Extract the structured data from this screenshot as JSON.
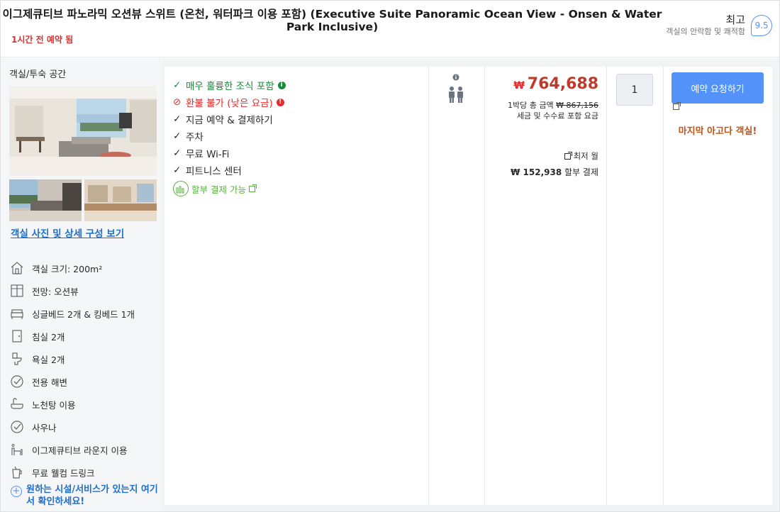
{
  "header": {
    "title_line1": "이그제큐티브 파노라믹 오션뷰 스위트 (온천, 워터파크 이용 포함) (Executive Suite Panoramic Ocean View - Onsen & Water",
    "title_line2": "Park Inclusive)",
    "booked_ago": "1시간 전 예약 됨",
    "rating_word": "최고",
    "rating_sub": "객실의 안락함 및 쾌적함",
    "rating_score": "9.5"
  },
  "room": {
    "section_title": "객실/투숙 공간",
    "photo_link": "객실 사진 및 상세 구성 보기",
    "amenities": [
      {
        "icon": "room-size-icon",
        "label": "객실 크기: 200m²"
      },
      {
        "icon": "window-view-icon",
        "label": "전망: 오션뷰"
      },
      {
        "icon": "bed-icon",
        "label": "싱글베드 2개 & 킹베드 1개"
      },
      {
        "icon": "door-icon",
        "label": "침실 2개"
      },
      {
        "icon": "toilet-icon",
        "label": "욕실 2개"
      },
      {
        "icon": "check-circle-icon",
        "label": "전용 해변"
      },
      {
        "icon": "bathtub-icon",
        "label": "노천탕 이용"
      },
      {
        "icon": "check-circle-icon",
        "label": "사우나"
      },
      {
        "icon": "lounge-icon",
        "label": "이그제큐티브 라운지 이용"
      },
      {
        "icon": "drink-icon",
        "label": "무료 웰컴 드링크"
      }
    ],
    "more_link": "원하는 시설/서비스가 있는지 여기서 확인하세요!"
  },
  "benefits": {
    "breakfast": "매우 훌륭한 조식 포함",
    "nonrefundable": "환불 불가 (낮은 요금)",
    "items": [
      "지금 예약 & 결제하기",
      "주차",
      "무료 Wi-Fi",
      "피트니스 센터"
    ],
    "installment": "할부 결제 가능"
  },
  "price": {
    "currency": "₩",
    "amount": "764,688",
    "per_night_label": "1박당 총 금액",
    "per_night_original": "₩ 867,156",
    "tax_note": "세금 및 수수료 포함 요금",
    "lowest_monthly": "최저 월",
    "installment_amount": "₩ 152,938",
    "installment_suffix": "할부 결제"
  },
  "booking": {
    "quantity": "1",
    "button_label": "예약 요청하기",
    "last_room": "마지막 아고다 객실!"
  },
  "colors": {
    "accent_blue": "#5392f9",
    "link_blue": "#1f6ec9",
    "price_red": "#c0392b",
    "alert_red": "#e12d2d",
    "success_green": "#1a8a3a",
    "urgency_orange": "#c0531a"
  }
}
